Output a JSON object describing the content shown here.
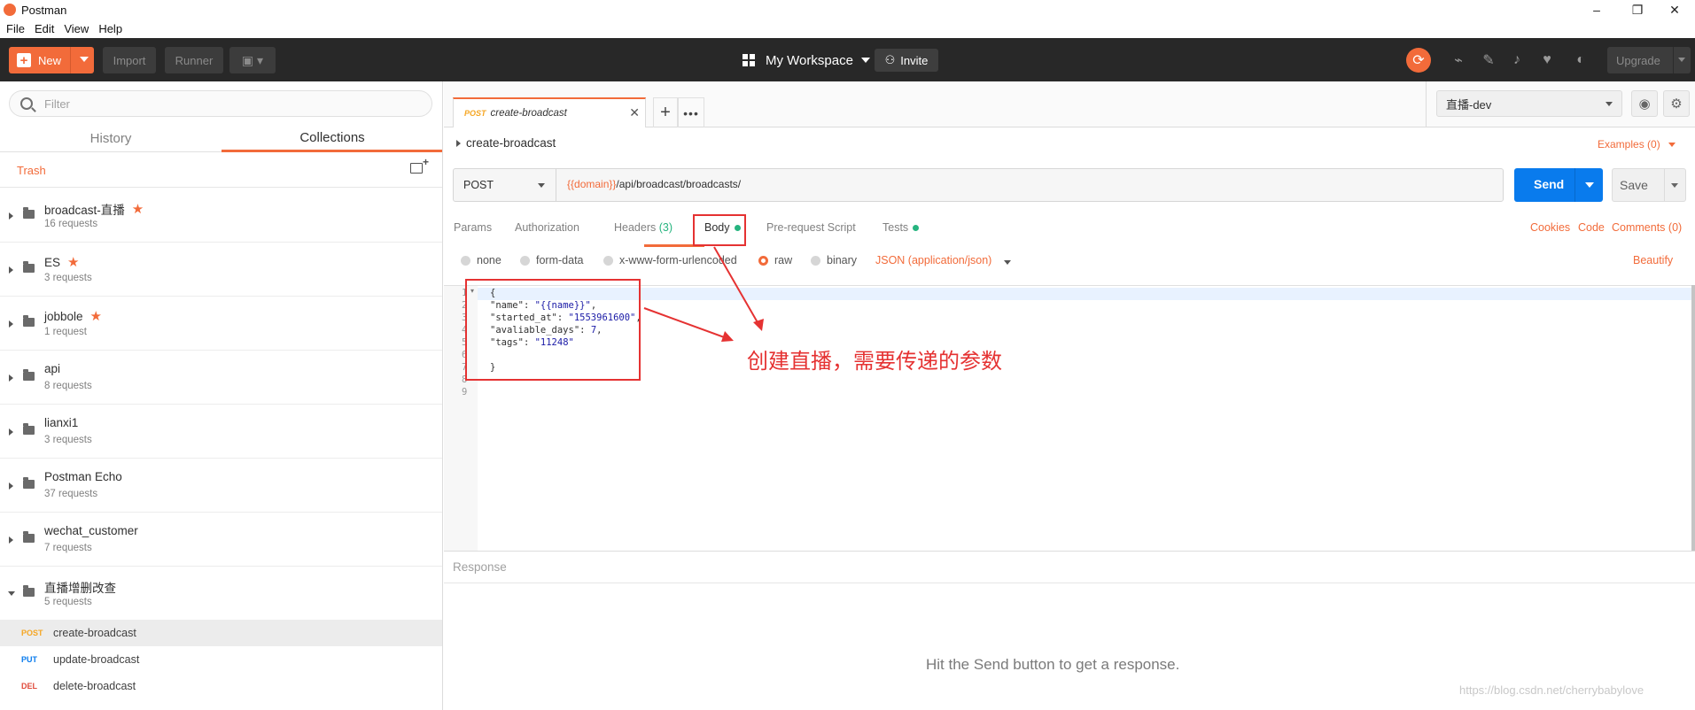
{
  "window": {
    "title": "Postman",
    "minimize": "–",
    "maximize": "❐",
    "close": "✕"
  },
  "menu": [
    "File",
    "Edit",
    "View",
    "Help"
  ],
  "header": {
    "new_label": "New",
    "import_label": "Import",
    "runner_label": "Runner",
    "workspace_label": "My Workspace",
    "invite_label": "Invite",
    "upgrade_label": "Upgrade"
  },
  "sidebar": {
    "filter_placeholder": "Filter",
    "tabs": [
      "History",
      "Collections"
    ],
    "active_tab": "Collections",
    "trash_label": "Trash",
    "collections": [
      {
        "name": "broadcast-直播",
        "count": "16 requests",
        "starred": true
      },
      {
        "name": "ES",
        "count": "3 requests",
        "starred": true
      },
      {
        "name": "jobbole",
        "count": "1 request",
        "starred": true
      },
      {
        "name": "api",
        "count": "8 requests",
        "starred": false
      },
      {
        "name": "lianxi1",
        "count": "3 requests",
        "starred": false
      },
      {
        "name": "Postman Echo",
        "count": "37 requests",
        "starred": false
      },
      {
        "name": "wechat_customer",
        "count": "7 requests",
        "starred": false
      },
      {
        "name": "直播增删改查",
        "count": "5 requests",
        "starred": false,
        "expanded": true
      }
    ],
    "requests": [
      {
        "method": "POST",
        "name": "create-broadcast",
        "color": "#f5a623",
        "active": true
      },
      {
        "method": "PUT",
        "name": "update-broadcast",
        "color": "#097bed",
        "active": false
      },
      {
        "method": "DEL",
        "name": "delete-broadcast",
        "color": "#e04b3c",
        "active": false
      }
    ]
  },
  "tab": {
    "method": "POST",
    "name": "create-broadcast"
  },
  "environment": {
    "selected": "直播-dev"
  },
  "request": {
    "name": "create-broadcast",
    "examples_label": "Examples (0)",
    "method": "POST",
    "url_var": "{{domain}}",
    "url_path": "/api/broadcast/broadcasts/",
    "send_label": "Send",
    "save_label": "Save"
  },
  "subtabs": {
    "params": "Params",
    "authorization": "Authorization",
    "headers": "Headers",
    "headers_count": "(3)",
    "body": "Body",
    "prerequest": "Pre-request Script",
    "tests": "Tests",
    "cookies": "Cookies",
    "code": "Code",
    "comments": "Comments (0)"
  },
  "body_types": {
    "none": "none",
    "form_data": "form-data",
    "urlencoded": "x-www-form-urlencoded",
    "raw": "raw",
    "binary": "binary",
    "content_type": "JSON (application/json)",
    "beautify": "Beautify"
  },
  "code_lines": [
    {
      "n": "1",
      "text": "{"
    },
    {
      "n": "2",
      "key": "\"name\"",
      "val": "\"{{name}}\"",
      "tail": ","
    },
    {
      "n": "3",
      "key": "\"started_at\"",
      "val": "\"1553961600\"",
      "tail": ","
    },
    {
      "n": "4",
      "key": "\"avaliable_days\"",
      "val": "7",
      "tail": ","
    },
    {
      "n": "5",
      "key": "\"tags\"",
      "val": "\"11248\"",
      "tail": ""
    },
    {
      "n": "6",
      "text": ""
    },
    {
      "n": "7",
      "text": "}"
    },
    {
      "n": "8",
      "text": ""
    },
    {
      "n": "9",
      "text": ""
    }
  ],
  "response": {
    "label": "Response",
    "hint": "Hit the Send button to get a response."
  },
  "annotation": {
    "text": "创建直播，需要传递的参数"
  },
  "watermark": "https://blog.csdn.net/cherrybabylove",
  "colors": {
    "accent": "#f26b3a",
    "send": "#097bed",
    "annotation": "#e53232",
    "header_bg": "#282828"
  }
}
